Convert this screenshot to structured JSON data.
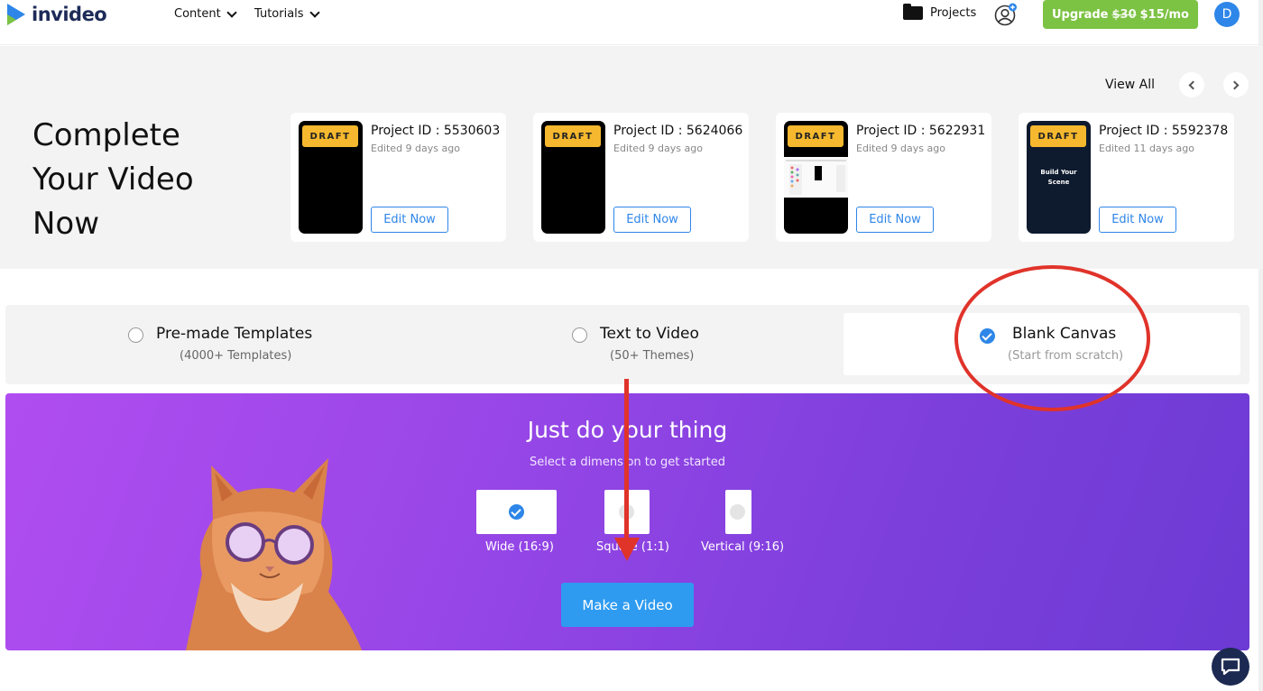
{
  "header": {
    "logo_text": "invideo",
    "nav": [
      {
        "label": "Content"
      },
      {
        "label": "Tutorials"
      }
    ],
    "projects_label": "Projects",
    "upgrade": {
      "prefix": "Upgrade",
      "old_price": "$30",
      "new_price": "$15/mo"
    },
    "avatar_initial": "D"
  },
  "drafts": {
    "headline": [
      "Complete",
      "Your Video",
      "Now"
    ],
    "view_all": "View All",
    "cards": [
      {
        "badge": "DRAFT",
        "project_id": "Project ID : 5530603",
        "edited": "Edited 9 days ago",
        "button": "Edit Now"
      },
      {
        "badge": "DRAFT",
        "project_id": "Project ID : 5624066",
        "edited": "Edited 9 days ago",
        "button": "Edit Now"
      },
      {
        "badge": "DRAFT",
        "project_id": "Project ID : 5622931",
        "edited": "Edited 9 days ago",
        "button": "Edit Now"
      },
      {
        "badge": "DRAFT",
        "project_id": "Project ID : 5592378",
        "edited": "Edited 11 days ago",
        "button": "Edit Now",
        "scene_text": "Build Your Scene"
      }
    ]
  },
  "options": [
    {
      "title": "Pre-made Templates",
      "subtitle": "(4000+ Templates)",
      "selected": false
    },
    {
      "title": "Text to Video",
      "subtitle": "(50+ Themes)",
      "selected": false
    },
    {
      "title": "Blank Canvas",
      "subtitle": "(Start from scratch)",
      "selected": true
    }
  ],
  "hero": {
    "title": "Just do your thing",
    "subtitle": "Select a dimension to get started",
    "dimensions": [
      {
        "label": "Wide (16:9)",
        "selected": true
      },
      {
        "label": "Square (1:1)",
        "selected": false
      },
      {
        "label": "Vertical (9:16)",
        "selected": false
      }
    ],
    "button": "Make a Video"
  },
  "colors": {
    "accent_blue": "#2e86e8",
    "upgrade_green": "#7cc243",
    "draft_yellow": "#f5b82e",
    "hero_purple": "#9a47e8",
    "annotation_red": "#e0332a"
  },
  "icons": [
    "logo-icon",
    "chevron-down-icon",
    "folder-icon",
    "add-user-icon",
    "chevron-left-icon",
    "chevron-right-icon",
    "check-icon",
    "chat-icon"
  ]
}
